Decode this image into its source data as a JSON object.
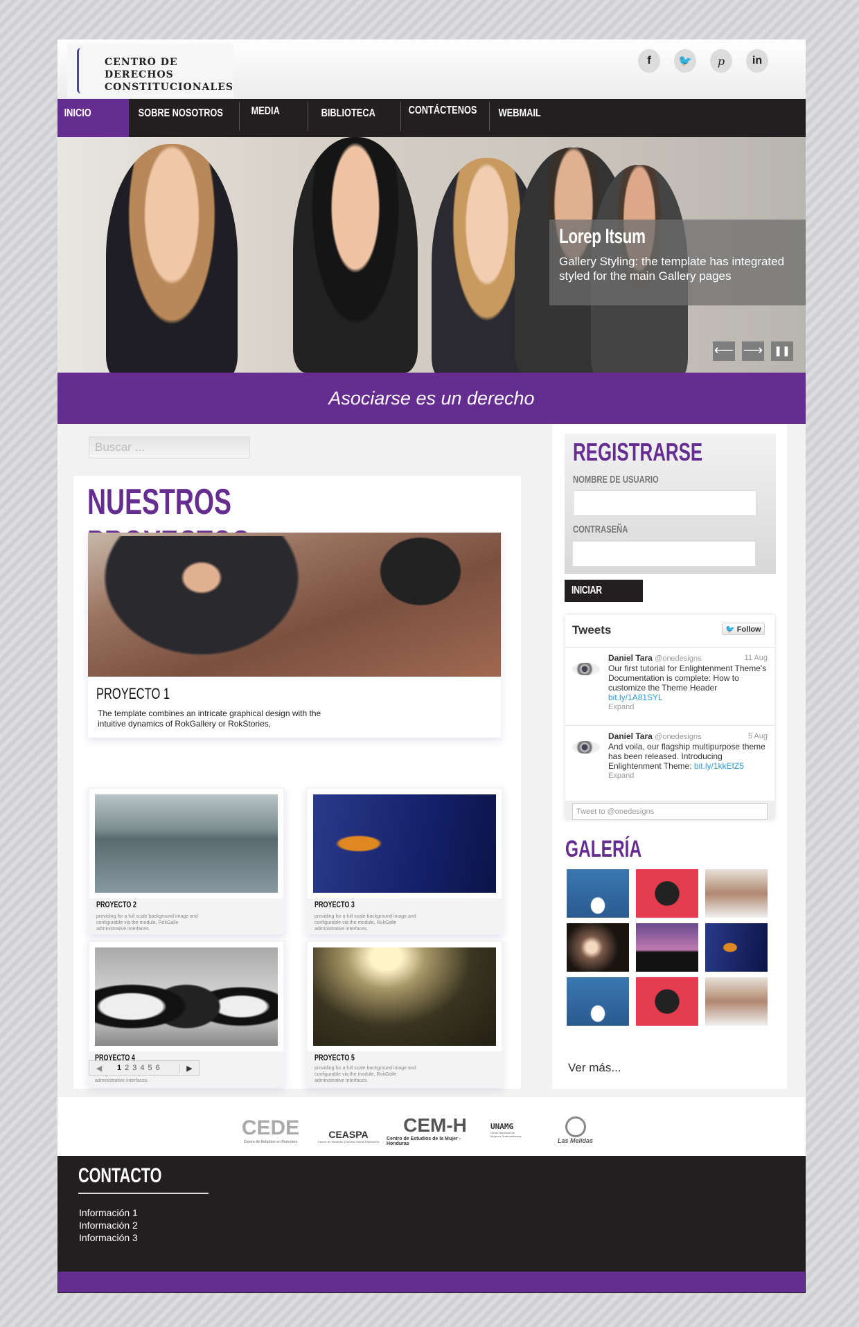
{
  "header": {
    "logo_text": [
      "CENTRO DE",
      "DERECHOS",
      "CONSTITUCIONALES"
    ],
    "social": [
      {
        "icon": "facebook-icon",
        "glyph": "f"
      },
      {
        "icon": "twitter-icon",
        "glyph": "t"
      },
      {
        "icon": "pinterest-icon",
        "glyph": "p"
      },
      {
        "icon": "linkedin-icon",
        "glyph": "in"
      }
    ]
  },
  "nav": {
    "items": [
      "INICIO",
      "SOBRE NOSOTROS",
      "MEDIA",
      "BIBLIOTECA",
      "CONTÁCTENOS",
      "WEBMAIL"
    ],
    "active": 0
  },
  "hero": {
    "title": "Lorep Itsum",
    "text": "Gallery Styling: the template has integrated styled for the main Gallery pages",
    "prev": "⟵",
    "next": "⟶",
    "pause": "❚❚"
  },
  "banner": "Asociarse es un derecho",
  "search": {
    "placeholder": "Buscar ..."
  },
  "projects": {
    "title": "NUESTROS PROYECTOS",
    "featured": {
      "title": "PROYECTO 1",
      "text": "The template combines an intricate graphical design with the intuitive dynamics of RokGallery or RokStories,"
    },
    "items": [
      {
        "title": "PROYECTO 2",
        "text": "providing for a full scale background image and configurable via the module, RokGalle administrative interfaces."
      },
      {
        "title": "PROYECTO 3",
        "text": "providing for a full scale background image and configurable via the module, RokGalle administrative interfaces."
      },
      {
        "title": "PROYECTO 4",
        "text": "providing for a full scale background image and configurable via the module, RokGalle administrative interfaces."
      },
      {
        "title": "PROYECTO 5",
        "text": "providing for a full scale background image and configurable via the module, RokGalle administrative interfaces."
      }
    ],
    "pager": {
      "prev": "◀",
      "pages": [
        "1",
        "2",
        "3",
        "4",
        "5",
        "6"
      ],
      "next": "▶",
      "current": "1"
    }
  },
  "register": {
    "title": "REGISTRARSE",
    "user_label": "NOMBRE DE USUARIO",
    "pass_label": "CONTRASEÑA",
    "button": "INICIAR SESIÓN"
  },
  "tweets": {
    "title": "Tweets",
    "follow": "Follow",
    "items": [
      {
        "name": "Daniel Tara",
        "handle": "@onedesigns",
        "date": "11 Aug",
        "text": "Our first tutorial for Enlightenment Theme's Documentation is complete: How to customize the Theme Header",
        "link": "bit.ly/1A81SYL",
        "expand": "Expand"
      },
      {
        "name": "Daniel Tara",
        "handle": "@onedesigns",
        "date": "5 Aug",
        "text": "And voila, our flagship multipurpose theme has been released. Introducing Enlightenment Theme:",
        "link": "bit.ly/1kkEfZ5",
        "expand": "Expand"
      }
    ],
    "input_placeholder": "Tweet to @onedesigns"
  },
  "gallery": {
    "title": "GALERÍA",
    "more": "Ver más..."
  },
  "partners": [
    {
      "name": "CEDE",
      "sub": "Centro de Estudios en Derechos"
    },
    {
      "name": "CEASPA",
      "sub": "Centro de Estudios y Acción Social Panameño"
    },
    {
      "name": "CEM-H",
      "sub": "Centro de Estudios de la Mujer - Honduras"
    },
    {
      "name": "UNAMG",
      "sub": "Unión Nacional de Mujeres Guatemaltecas"
    },
    {
      "name": "Las Melidas",
      "sub": ""
    }
  ],
  "footer": {
    "title": "CONTACTO",
    "items": [
      "Información 1",
      "Información 2",
      "Información 3"
    ]
  },
  "colors": {
    "purple": "#652d90",
    "dark": "#231f20"
  }
}
